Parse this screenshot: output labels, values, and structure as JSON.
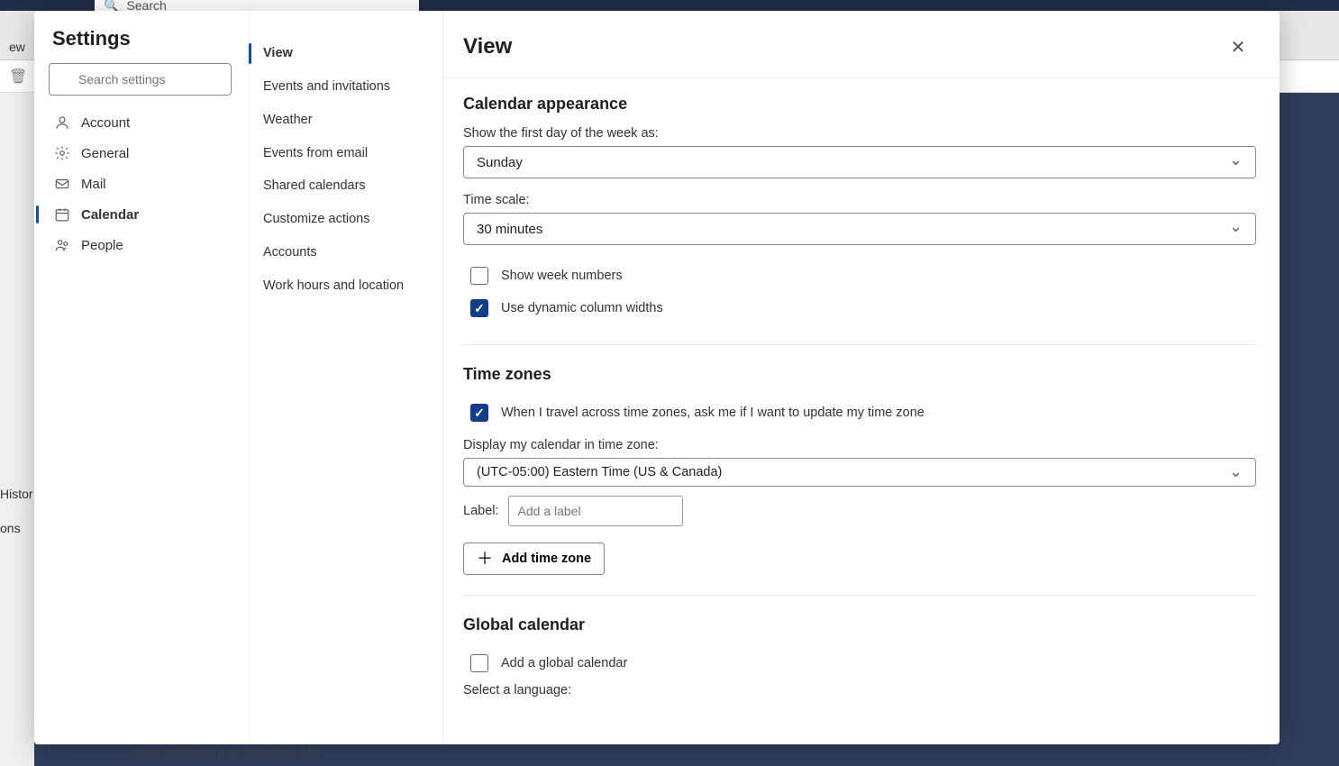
{
  "background": {
    "search_placeholder": "Search",
    "ribbon_tab_partial": "ew",
    "side_fragments": [
      "Histor",
      "ons"
    ],
    "notification_partial": "New notification on Installing Win"
  },
  "settings": {
    "title": "Settings",
    "search_placeholder": "Search settings",
    "categories": [
      {
        "id": "account",
        "label": "Account",
        "active": false
      },
      {
        "id": "general",
        "label": "General",
        "active": false
      },
      {
        "id": "mail",
        "label": "Mail",
        "active": false
      },
      {
        "id": "calendar",
        "label": "Calendar",
        "active": true
      },
      {
        "id": "people",
        "label": "People",
        "active": false
      }
    ],
    "subnav": [
      {
        "label": "View",
        "active": true
      },
      {
        "label": "Events and invitations",
        "active": false
      },
      {
        "label": "Weather",
        "active": false
      },
      {
        "label": "Events from email",
        "active": false
      },
      {
        "label": "Shared calendars",
        "active": false
      },
      {
        "label": "Customize actions",
        "active": false
      },
      {
        "label": "Accounts",
        "active": false
      },
      {
        "label": "Work hours and location",
        "active": false
      }
    ],
    "page_title": "View",
    "sections": {
      "appearance": {
        "heading": "Calendar appearance",
        "first_day_label": "Show the first day of the week as:",
        "first_day_value": "Sunday",
        "time_scale_label": "Time scale:",
        "time_scale_value": "30 minutes",
        "show_week_numbers_label": "Show week numbers",
        "show_week_numbers_checked": false,
        "dynamic_widths_label": "Use dynamic column widths",
        "dynamic_widths_checked": true
      },
      "timezones": {
        "heading": "Time zones",
        "travel_prompt_label": "When I travel across time zones, ask me if I want to update my time zone",
        "travel_prompt_checked": true,
        "display_tz_label": "Display my calendar in time zone:",
        "display_tz_value": "(UTC-05:00) Eastern Time (US & Canada)",
        "label_field_label": "Label:",
        "label_placeholder": "Add a label",
        "add_tz_button": "Add time zone"
      },
      "global": {
        "heading": "Global calendar",
        "add_global_label": "Add a global calendar",
        "add_global_checked": false,
        "select_language_label": "Select a language:"
      }
    }
  }
}
